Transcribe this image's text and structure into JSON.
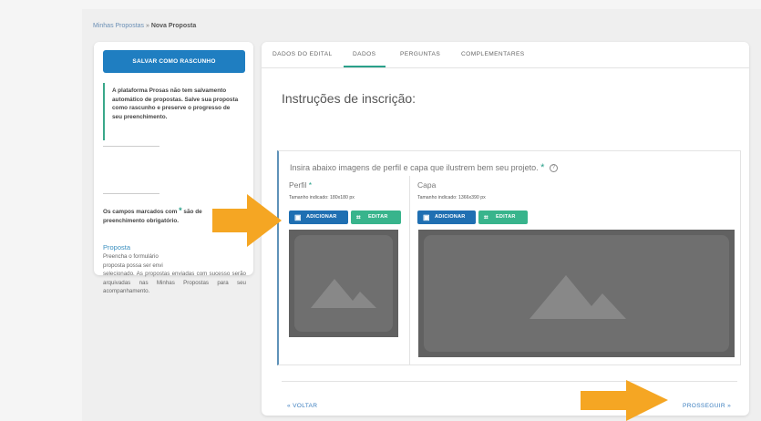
{
  "breadcrumb": {
    "parent": "Minhas Propostas",
    "separator": " » ",
    "current": "Nova Proposta"
  },
  "sidebar": {
    "save_draft_label": "SALVAR COMO RASCUNHO",
    "notice": "A plataforma Prosas não tem salvamento automático de propostas. Salve sua proposta como rascunho e preserve o progresso de seu preenchimento.",
    "required_prefix": "Os campos marcados com",
    "required_star": "*",
    "required_suffix": "são de preenchimento obrigatório.",
    "proposta_title": "Proposta",
    "proposta_text_1": "Preencha o formulário",
    "proposta_text_2": "proposta possa ser envi",
    "proposta_text_3": "selecionado. As propostas enviadas com sucesso serão arquivadas nas Minhas Propostas para seu acompanhamento."
  },
  "tabs": [
    {
      "label": "DADOS DO EDITAL",
      "active": false
    },
    {
      "label": "DADOS",
      "active": true
    },
    {
      "label": "PERGUNTAS",
      "active": false
    },
    {
      "label": "COMPLEMENTARES",
      "active": false
    }
  ],
  "main": {
    "section_title": "Instruções de inscrição:",
    "upload_intro": "Insira abaixo imagens de perfil e capa que ilustrem bem seu projeto.",
    "upload_star": "*",
    "help_icon": "?",
    "profile": {
      "label": "Perfil",
      "star": "*",
      "size_hint": "Tamanho indicado: 180x180 px"
    },
    "cover": {
      "label": "Capa",
      "size_hint": "Tamanho indicado: 1366x390 px"
    },
    "add_label": "ADICIONAR",
    "edit_label": "EDITAR",
    "back_label": "« VOLTAR",
    "next_label": "PROSSEGUIR »"
  },
  "icons": {
    "add": "image-add-icon",
    "edit": "crop-icon",
    "placeholder": "image-placeholder-icon",
    "arrow": "arrow-right-icon"
  },
  "colors": {
    "primary": "#1f7ec1",
    "accent": "#2aa08a",
    "add_button": "#1f6fb2",
    "edit_button": "#38b48c",
    "arrow": "#f5a623",
    "placeholder": "#616161"
  }
}
